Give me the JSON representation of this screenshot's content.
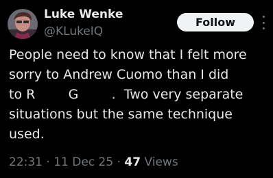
{
  "author": {
    "display_name": "Luke Wenke",
    "handle": "@KLukeIQ"
  },
  "actions": {
    "follow_label": "Follow",
    "more_icon": "more-vertical-icon"
  },
  "tweet": {
    "lines": [
      "People need to know that I felt more",
      "sorry to Andrew Cuomo than I did",
      "to R        G        .  Two very separate",
      "situations but the same technique",
      "used."
    ]
  },
  "meta": {
    "time": "22:31",
    "separator": "·",
    "date": "11 Dec 25",
    "views_count": "47",
    "views_label": "Views"
  },
  "colors": {
    "background": "#000000",
    "text_primary": "#e7e9ea",
    "text_secondary": "#71767b",
    "follow_bg": "#eff3f4",
    "follow_text": "#0f1419"
  }
}
